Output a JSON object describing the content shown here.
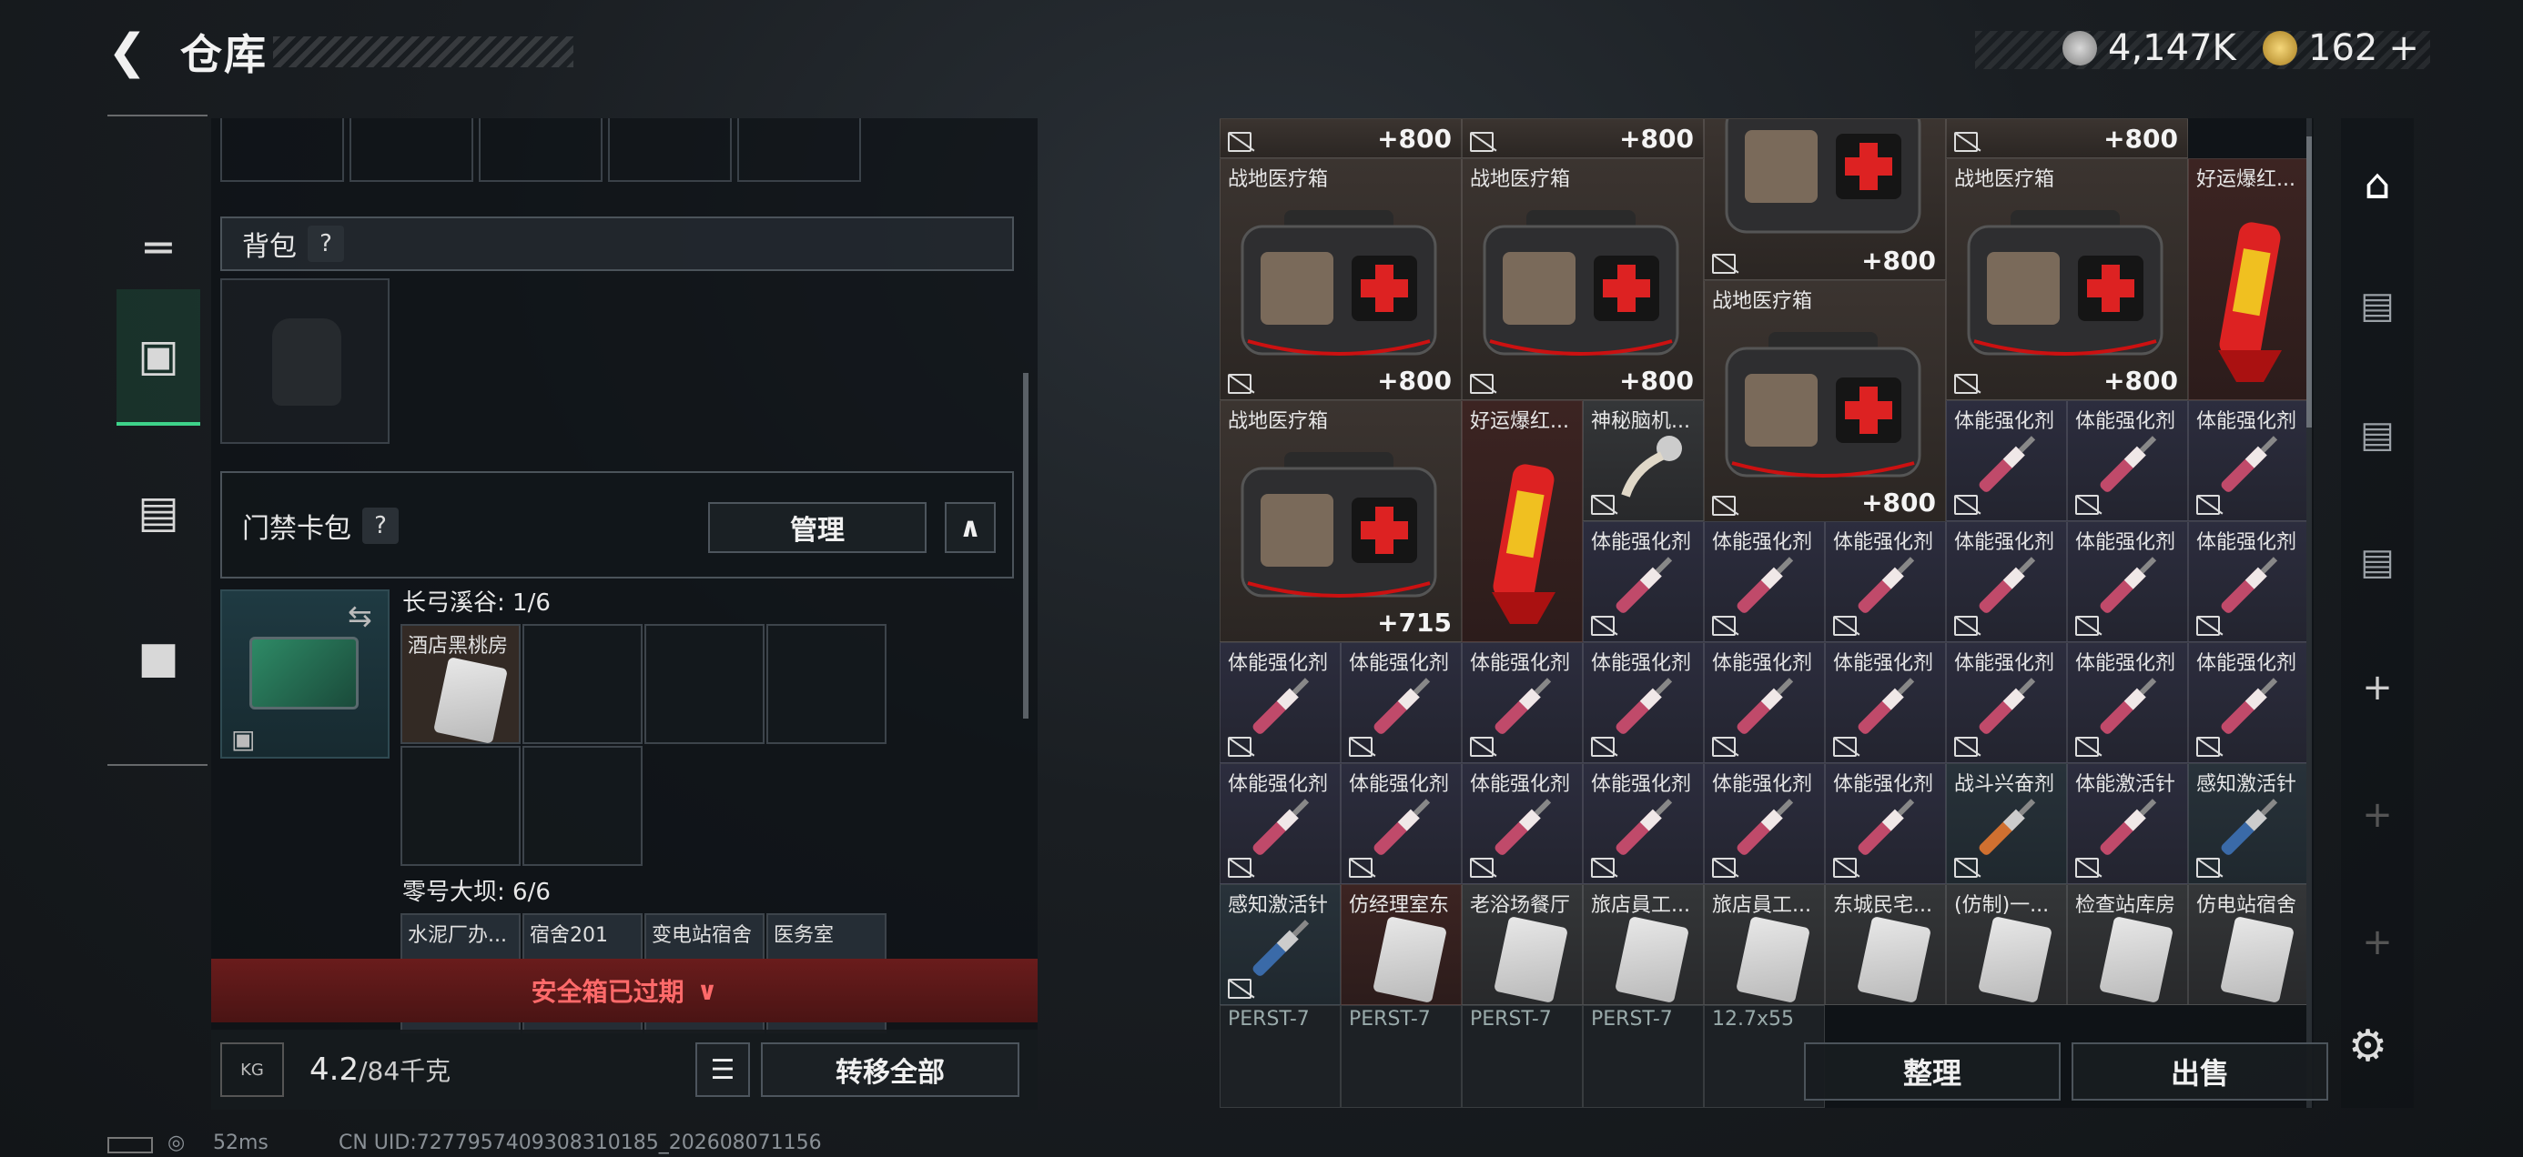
{
  "header": {
    "title": "仓库",
    "currency_a": "4,147K",
    "currency_b": "162",
    "plus": "+"
  },
  "left": {
    "backpack_label": "背包",
    "help": "?",
    "keycard_label": "门禁卡包",
    "manage_btn": "管理",
    "map1": "长弓溪谷: 1/6",
    "map1_card": "酒店黑桃房",
    "map2": "零号大坝: 6/6",
    "map2_cards": [
      "水泥厂办...",
      "宿舍201",
      "变电站宿舍",
      "医务室"
    ],
    "safe_expired": "安全箱已过期",
    "weight_value": "4.2",
    "weight_capacity": "/84千克",
    "transfer_all": "转移全部",
    "weight_icon": "KG"
  },
  "stash": {
    "qty_800": "+800",
    "qty_715": "+715",
    "names": {
      "medkit": "战地医疗箱",
      "firecracker": "好运爆红...",
      "brain": "神秘脑机...",
      "stim": "体能强化剂",
      "combat": "战斗兴奋剂",
      "activate": "体能激活针",
      "perception": "感知激活针",
      "card_row": [
        "感知激活针",
        "仿经理室东",
        "老浴场餐厅",
        "旅店員工...",
        "旅店員工...",
        "东城民宅...",
        "(仿制)一...",
        "检查站库房",
        "仿电站宿舍"
      ],
      "ammo_row": [
        "PERST-7",
        "PERST-7",
        "PERST-7",
        "PERST-7",
        "12.7x55"
      ]
    },
    "sort_btn": "整理",
    "sell_btn": "出售"
  },
  "status": {
    "ping": "52ms",
    "uid": "CN UID:7277957409308310185_202608071156"
  },
  "colors": {
    "accent_green": "#3ed38a",
    "danger_red": "#c93232",
    "brown_bg": "#3b3430",
    "purple_bg": "#2c2d3e"
  }
}
